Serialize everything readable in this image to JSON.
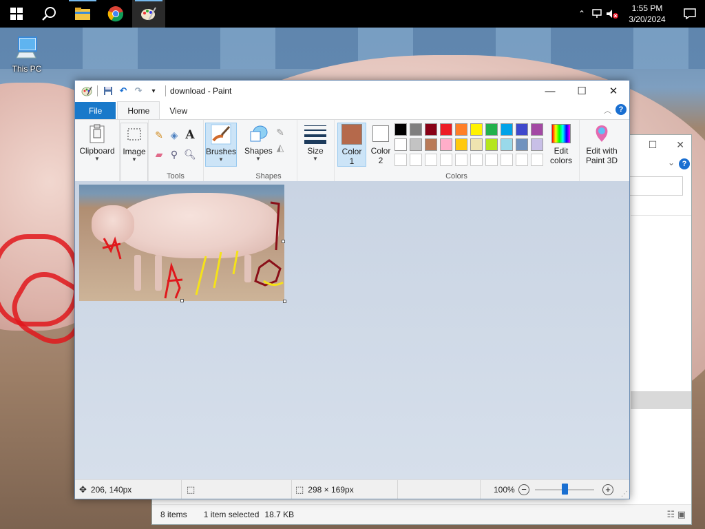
{
  "taskbar": {
    "apps": [
      {
        "name": "start-button",
        "icon": "windows-logo-icon"
      },
      {
        "name": "search-button",
        "icon": "search-icon"
      },
      {
        "name": "file-explorer-button",
        "icon": "folder-icon"
      },
      {
        "name": "chrome-button",
        "icon": "chrome-icon"
      },
      {
        "name": "paint-button",
        "icon": "paint-palette-icon"
      }
    ],
    "clock": {
      "time": "1:55 PM",
      "date": "3/20/2024"
    }
  },
  "desktop": {
    "this_pc_label": "This PC"
  },
  "explorer": {
    "items_count": "8 items",
    "selection": "1 item selected",
    "size": "18.7 KB"
  },
  "paint": {
    "title": "download - Paint",
    "tabs": {
      "file": "File",
      "home": "Home",
      "view": "View"
    },
    "groups": {
      "tools": "Tools",
      "shapes": "Shapes",
      "colors": "Colors"
    },
    "buttons": {
      "clipboard": "Clipboard",
      "image": "Image",
      "brushes": "Brushes",
      "shapes": "Shapes",
      "size": "Size",
      "color1_line1": "Color",
      "color1_line2": "1",
      "color2_line1": "Color",
      "color2_line2": "2",
      "edit_colors_line1": "Edit",
      "edit_colors_line2": "colors",
      "paint3d_line1": "Edit with",
      "paint3d_line2": "Paint 3D"
    },
    "color1": "#b5694b",
    "color2": "#ffffff",
    "palette_row1": [
      "#000000",
      "#7f7f7f",
      "#880015",
      "#ed1c24",
      "#ff7f27",
      "#fff200",
      "#22b14c",
      "#00a2e8",
      "#3f48cc",
      "#a349a4"
    ],
    "palette_row2": [
      "#ffffff",
      "#c3c3c3",
      "#b97a57",
      "#ffaec9",
      "#ffc90e",
      "#efe4b0",
      "#b5e61d",
      "#99d9ea",
      "#7092be",
      "#c8bfe7"
    ],
    "status": {
      "cursor": "206, 140px",
      "image_size": "298 × 169px",
      "zoom": "100%"
    }
  }
}
